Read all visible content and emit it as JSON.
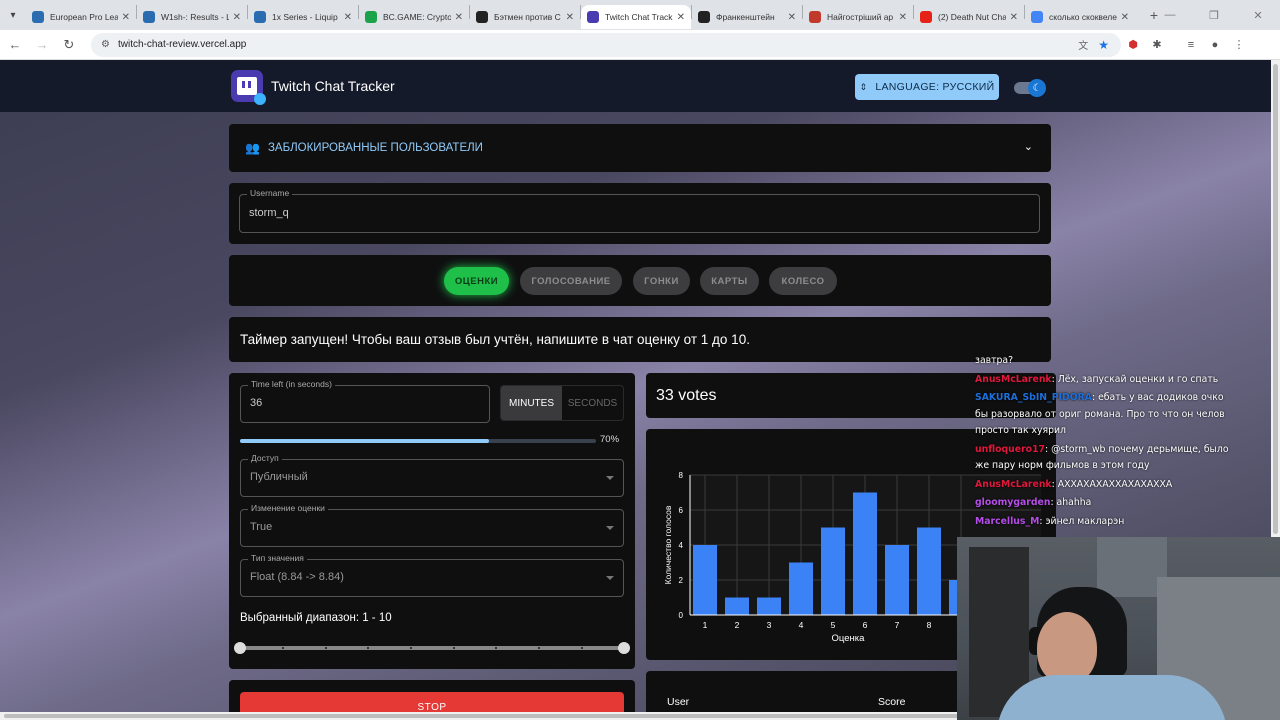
{
  "browser": {
    "tabs": [
      {
        "label": "European Pro Lea",
        "fav": "#2b6cb0",
        "active": false
      },
      {
        "label": "W1sh-: Results - L",
        "fav": "#2b6cb0",
        "active": false
      },
      {
        "label": "1x Series - Liquip",
        "fav": "#2b6cb0",
        "active": false
      },
      {
        "label": "BC.GAME: Crypto",
        "fav": "#1aa34a",
        "active": false
      },
      {
        "label": "Бэтмен против С",
        "fav": "#222222",
        "active": false
      },
      {
        "label": "Twitch Chat Track",
        "fav": "#4b3bb0",
        "active": true
      },
      {
        "label": "Франкенштейн",
        "fav": "#222222",
        "active": false
      },
      {
        "label": "Найгостріший ар",
        "fav": "#c0392b",
        "active": false
      },
      {
        "label": "(2) Death Nut Cha",
        "fav": "#e62117",
        "active": false
      },
      {
        "label": "сколько скоквеле",
        "fav": "#4285f4",
        "active": false
      }
    ],
    "url": "twitch-chat-review.vercel.app",
    "accent": "#1a73e8"
  },
  "app": {
    "title": "Twitch Chat Tracker",
    "language_label": "LANGUAGE: РУССКИЙ"
  },
  "blocked": {
    "title": "ЗАБЛОКИРОВАННЫЕ ПОЛЬЗОВАТЕЛИ"
  },
  "username": {
    "label": "Username",
    "value": "storm_q"
  },
  "modes": {
    "items": [
      "ОЦЕНКИ",
      "ГОЛОСОВАНИЕ",
      "ГОНКИ",
      "КАРТЫ",
      "КОЛЕСО"
    ],
    "active_index": 0,
    "active_color": "#1ec04a"
  },
  "banner": "Таймер запущен! Чтобы ваш отзыв был учтён, напишите в чат оценку от 1 до 10.",
  "timer": {
    "label": "Time left (in seconds)",
    "value": "36",
    "unit_minutes": "MINUTES",
    "unit_seconds": "SECONDS",
    "unit_active": "MINUTES",
    "progress": 70,
    "progress_label": "70%"
  },
  "access": {
    "label": "Доступ",
    "value": "Публичный"
  },
  "rating_change": {
    "label": "Изменение оценки",
    "value": "True"
  },
  "value_type": {
    "label": "Тип значения",
    "value": "Float (8.84 -> 8.84)"
  },
  "range": {
    "label": "Выбранный диапазон: 1 - 10",
    "min": 1,
    "max": 10
  },
  "votes": "33 votes",
  "chart_data": {
    "type": "bar",
    "categories": [
      "1",
      "2",
      "3",
      "4",
      "5",
      "6",
      "7",
      "8",
      "9"
    ],
    "values": [
      4,
      1,
      1,
      3,
      5,
      7,
      4,
      5,
      2
    ],
    "xlabel": "Оценка",
    "ylabel": "Количество голосов",
    "ylim": [
      0,
      8
    ],
    "yticks": [
      "0",
      "2",
      "4",
      "6",
      "8"
    ],
    "bar_color": "#3b82f6",
    "grid": true
  },
  "stop_label": "STOP",
  "results_table": {
    "columns": [
      "User",
      "Score"
    ]
  },
  "chat": [
    {
      "user": "",
      "text": "завтра?",
      "color": "#ffffff"
    },
    {
      "user": "AnusMcLarenk",
      "text": ": Лёх, запускай оценки и го спать",
      "color": "#e0183c"
    },
    {
      "user": "SAKURA_SbIN_PIDORA",
      "text": ": ебать у вас додиков очко бы разорвало от ориг романа. Про то что он челов просто так хуярил",
      "color": "#1e6fd9"
    },
    {
      "user": "unfloquero17",
      "text": ": @storm_wb почему дерьмище, было же пару норм фильмов в этом году",
      "color": "#e0183c"
    },
    {
      "user": "AnusMcLarenk",
      "text": ": АХХАХАХАХХАХАХАХХА",
      "color": "#e0183c"
    },
    {
      "user": "gloomygarden",
      "text": ": ahahha",
      "color": "#b54de8"
    },
    {
      "user": "Marcellus_M",
      "text": ": эйнел макларэн",
      "color": "#b54de8"
    }
  ]
}
